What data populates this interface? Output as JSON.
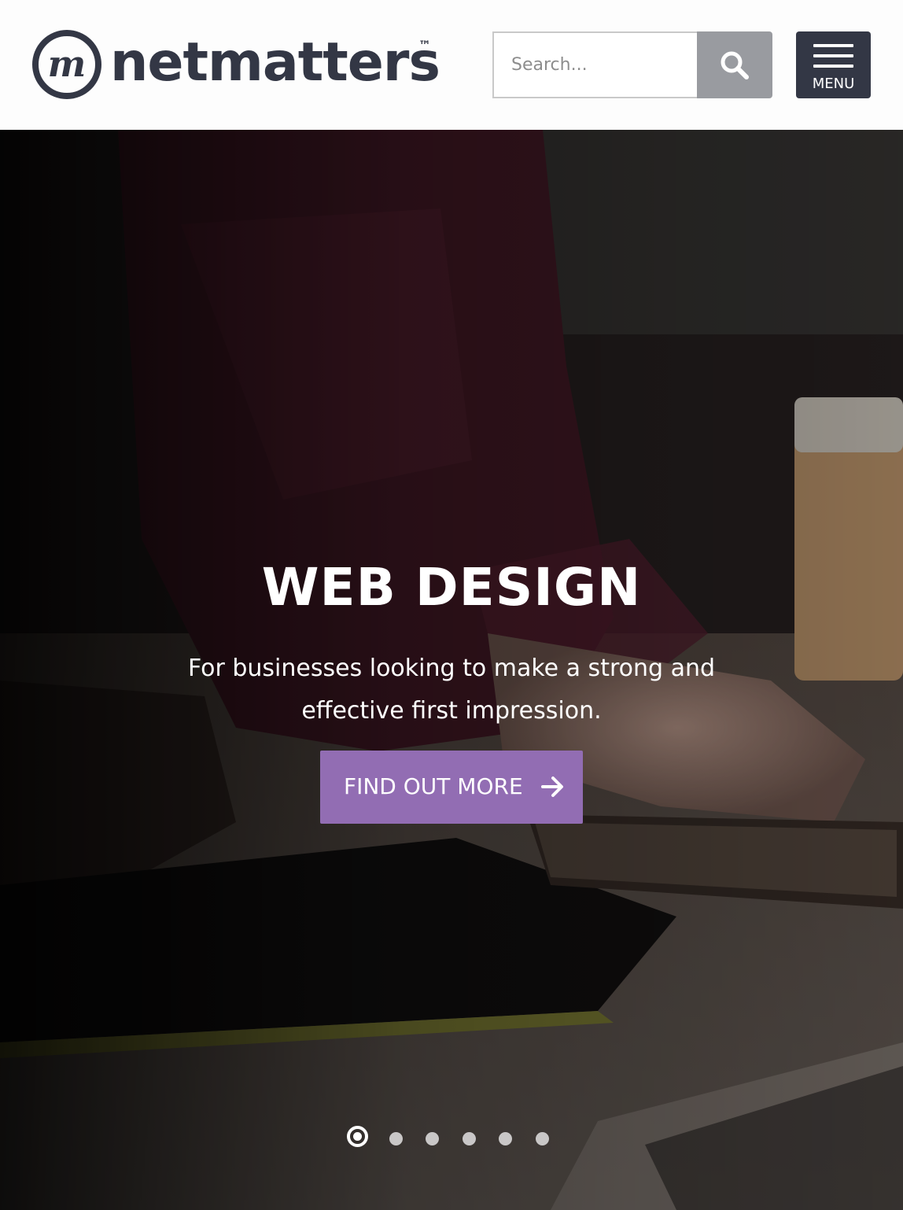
{
  "header": {
    "logo_text": "netmatters",
    "logo_mark": "m",
    "trademark": "™",
    "search": {
      "placeholder": "Search...",
      "icon": "search-icon"
    },
    "menu": {
      "label": "MENU",
      "icon": "hamburger-icon"
    }
  },
  "hero": {
    "title": "WEB DESIGN",
    "subtitle": "For businesses looking to make a strong and effective first impression.",
    "cta": {
      "label": "FIND OUT MORE",
      "icon": "arrow-right-icon"
    },
    "slides": {
      "count": 6,
      "active": 1
    }
  },
  "colors": {
    "brand_dark": "#333745",
    "search_button": "#999ba0",
    "cta_purple": "#926db3",
    "dot_inactive": "#c9c7c7"
  }
}
